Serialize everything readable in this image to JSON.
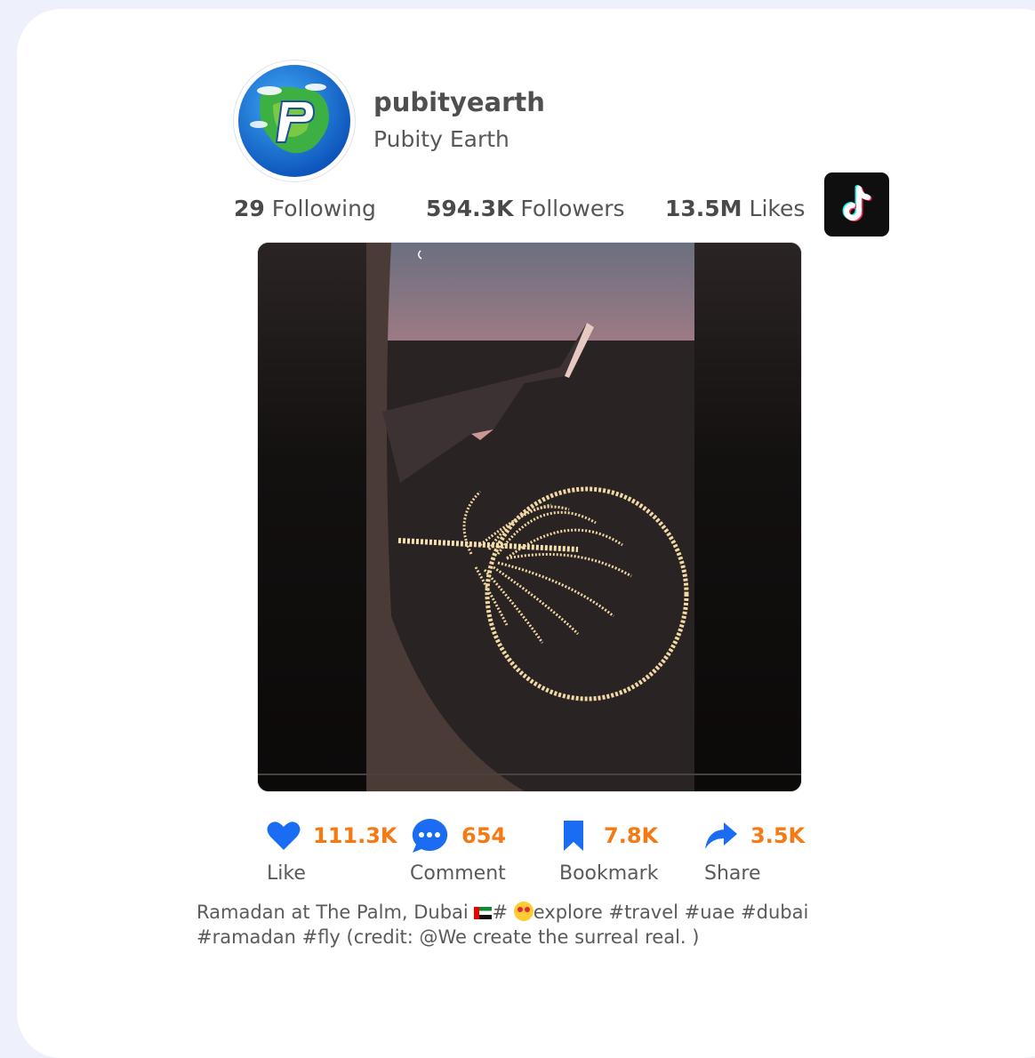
{
  "profile": {
    "username": "pubityearth",
    "display_name": "Pubity Earth",
    "avatar_icon": "globe-p-logo-icon"
  },
  "stats": {
    "following": {
      "value": "29",
      "label": "Following"
    },
    "followers": {
      "value": "594.3K",
      "label": "Followers"
    },
    "likes": {
      "value": "13.5M",
      "label": "Likes"
    }
  },
  "platform": {
    "icon": "tiktok-icon"
  },
  "video": {
    "description_icon": "airplane-wing-palm-island-thumbnail"
  },
  "actions": [
    {
      "icon": "heart-icon",
      "count": "111.3K",
      "label": "Like"
    },
    {
      "icon": "comment-icon",
      "count": "654",
      "label": "Comment"
    },
    {
      "icon": "bookmark-icon",
      "count": "7.8K",
      "label": "Bookmark"
    },
    {
      "icon": "share-icon",
      "count": "3.5K",
      "label": "Share"
    }
  ],
  "caption": {
    "text_before_flag": "Ramadan at The Palm, Dubai ",
    "text_after_flag": "# ",
    "text_after_emoji": "explore #travel #uae #dubai #ramadan #fly (credit: @We create the surreal real. )"
  },
  "colors": {
    "accent_count": "#f57a14",
    "icon_blue": "#1a6df2",
    "background": "#eef1fb",
    "card": "#ffffff"
  }
}
